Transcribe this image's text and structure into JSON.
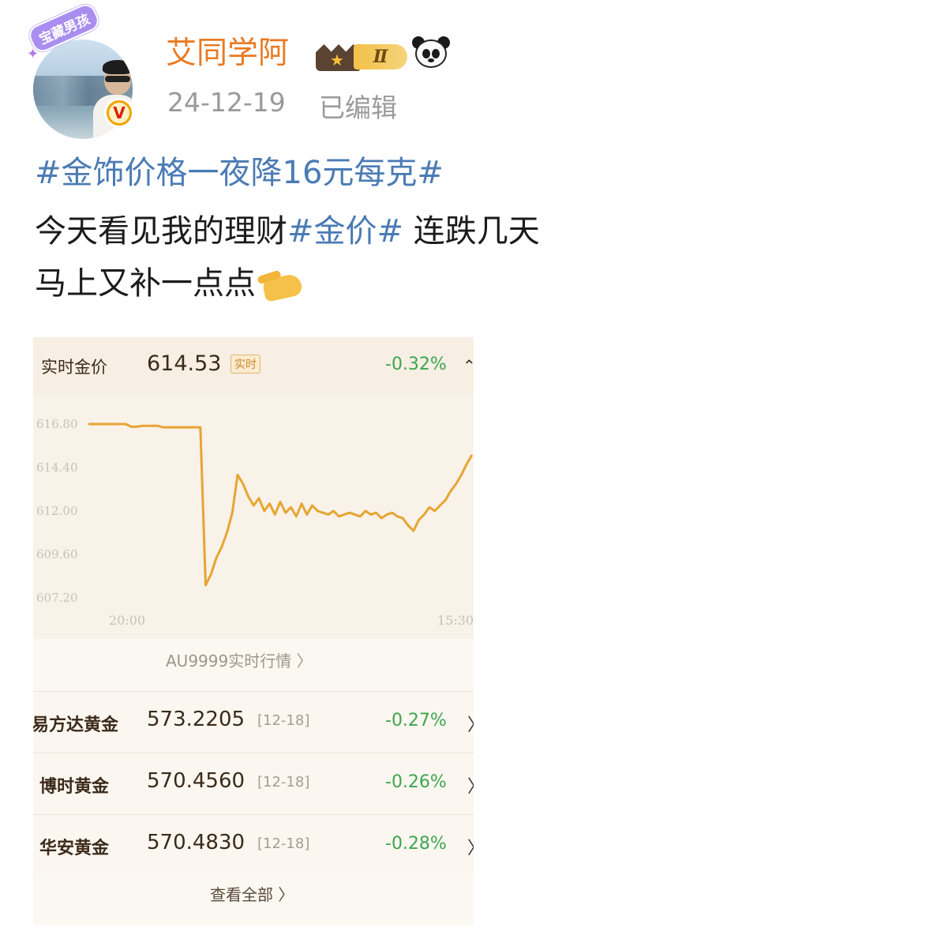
{
  "profile": {
    "sticker_text": "宝藏男孩",
    "username": "艾同学阿",
    "level": "Ⅱ",
    "post_date": "24-12-19",
    "edited_label": "已编辑",
    "verified_symbol": "V"
  },
  "post": {
    "topic_line": "#金饰价格一夜降16元每克#",
    "line2_before": "今天看见我的理财",
    "line2_topic": "#金价#",
    "line2_after": " 连跌几天",
    "line3": "马上又补一点点"
  },
  "card": {
    "header": {
      "label": "实时金价",
      "price": "614.53",
      "tag": "实时",
      "change": "-0.32%",
      "arrow": "⌃"
    },
    "chart_link": "AU9999实时行情 〉",
    "funds": [
      {
        "name": "易方达黄金",
        "value": "573.2205",
        "date": "[12-18]",
        "change": "-0.27%",
        "arrow": "〉"
      },
      {
        "name": "博时黄金",
        "value": "570.4560",
        "date": "[12-18]",
        "change": "-0.26%",
        "arrow": "〉"
      },
      {
        "name": "华安黄金",
        "value": "570.4830",
        "date": "[12-18]",
        "change": "-0.28%",
        "arrow": "〉"
      }
    ],
    "view_all": "查看全部 〉"
  },
  "chart_data": {
    "type": "line",
    "x_ticks": [
      "20:00",
      "15:30"
    ],
    "y_ticks": [
      "616.80",
      "614.40",
      "612.00",
      "609.60",
      "607.20"
    ],
    "ylim": [
      607.2,
      616.8
    ],
    "color": "#e7a532",
    "series": [
      {
        "values": [
          616.8,
          616.8,
          616.8,
          616.8,
          616.8,
          616.8,
          616.8,
          616.8,
          616.65,
          616.65,
          616.7,
          616.7,
          616.7,
          616.7,
          616.62,
          616.62,
          616.62,
          616.62,
          616.62,
          616.62,
          616.62,
          616.62,
          607.9,
          608.5,
          609.4,
          610.0,
          610.8,
          611.9,
          614.0,
          613.5,
          612.8,
          612.3,
          612.7,
          612.0,
          612.4,
          611.8,
          612.5,
          611.9,
          612.2,
          611.7,
          612.4,
          611.8,
          612.3,
          612.0,
          611.9,
          611.8,
          612.0,
          611.7,
          611.8,
          611.9,
          611.8,
          611.7,
          612.0,
          611.8,
          611.9,
          611.6,
          611.8,
          611.9,
          611.7,
          611.6,
          611.2,
          610.9,
          611.5,
          611.8,
          612.2,
          612.0,
          612.3,
          612.6,
          613.1,
          613.5,
          614.0,
          614.6,
          615.1
        ]
      }
    ]
  }
}
